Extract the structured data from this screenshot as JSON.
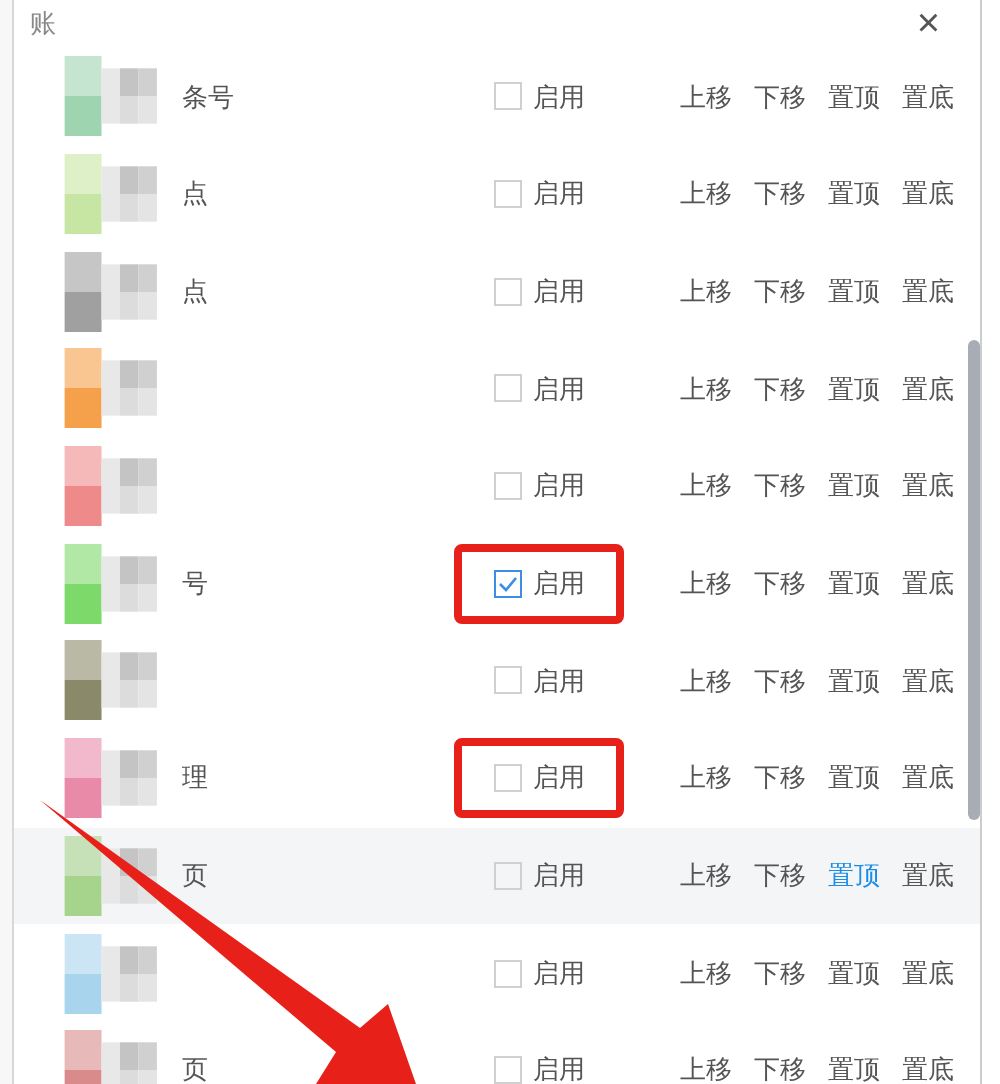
{
  "dialog": {
    "title": "账",
    "close": "×"
  },
  "rows": [
    {
      "name": "条号",
      "color": "#9fd4b0",
      "enabled": false,
      "hovered": false,
      "marked": false,
      "enable_label": "启用",
      "actions": [
        {
          "label": "上移",
          "hover": false
        },
        {
          "label": "下移",
          "hover": false
        },
        {
          "label": "置顶",
          "hover": false
        },
        {
          "label": "置底",
          "hover": false
        }
      ]
    },
    {
      "name": "点",
      "color": "#c7e6a4",
      "enabled": false,
      "hovered": false,
      "marked": false,
      "enable_label": "启用",
      "actions": [
        {
          "label": "上移",
          "hover": false
        },
        {
          "label": "下移",
          "hover": false
        },
        {
          "label": "置顶",
          "hover": false
        },
        {
          "label": "置底",
          "hover": false
        }
      ]
    },
    {
      "name": "点",
      "color": "#a0a0a0",
      "enabled": false,
      "hovered": false,
      "marked": false,
      "enable_label": "启用",
      "actions": [
        {
          "label": "上移",
          "hover": false
        },
        {
          "label": "下移",
          "hover": false
        },
        {
          "label": "置顶",
          "hover": false
        },
        {
          "label": "置底",
          "hover": false
        }
      ]
    },
    {
      "name": "",
      "color": "#f5a04a",
      "enabled": false,
      "hovered": false,
      "marked": false,
      "enable_label": "启用",
      "actions": [
        {
          "label": "上移",
          "hover": false
        },
        {
          "label": "下移",
          "hover": false
        },
        {
          "label": "置顶",
          "hover": false
        },
        {
          "label": "置底",
          "hover": false
        }
      ]
    },
    {
      "name": "",
      "color": "#ef8a8a",
      "enabled": false,
      "hovered": false,
      "marked": false,
      "enable_label": "启用",
      "actions": [
        {
          "label": "上移",
          "hover": false
        },
        {
          "label": "下移",
          "hover": false
        },
        {
          "label": "置顶",
          "hover": false
        },
        {
          "label": "置底",
          "hover": false
        }
      ]
    },
    {
      "name": "号",
      "color": "#7ed96b",
      "enabled": true,
      "hovered": false,
      "marked": true,
      "enable_label": "启用",
      "actions": [
        {
          "label": "上移",
          "hover": false
        },
        {
          "label": "下移",
          "hover": false
        },
        {
          "label": "置顶",
          "hover": false
        },
        {
          "label": "置底",
          "hover": false
        }
      ]
    },
    {
      "name": "",
      "color": "#8a8a6a",
      "enabled": false,
      "hovered": false,
      "marked": false,
      "enable_label": "启用",
      "actions": [
        {
          "label": "上移",
          "hover": false
        },
        {
          "label": "下移",
          "hover": false
        },
        {
          "label": "置顶",
          "hover": false
        },
        {
          "label": "置底",
          "hover": false
        }
      ]
    },
    {
      "name": "理",
      "color": "#e88aa8",
      "enabled": false,
      "hovered": false,
      "marked": true,
      "enable_label": "启用",
      "actions": [
        {
          "label": "上移",
          "hover": false
        },
        {
          "label": "下移",
          "hover": false
        },
        {
          "label": "置顶",
          "hover": false
        },
        {
          "label": "置底",
          "hover": false
        }
      ]
    },
    {
      "name": "页",
      "color": "#a6d48c",
      "enabled": false,
      "hovered": true,
      "marked": false,
      "enable_label": "启用",
      "actions": [
        {
          "label": "上移",
          "hover": false
        },
        {
          "label": "下移",
          "hover": false
        },
        {
          "label": "置顶",
          "hover": true
        },
        {
          "label": "置底",
          "hover": false
        }
      ]
    },
    {
      "name": "",
      "color": "#a8d4ee",
      "enabled": false,
      "hovered": false,
      "marked": false,
      "enable_label": "启用",
      "actions": [
        {
          "label": "上移",
          "hover": false
        },
        {
          "label": "下移",
          "hover": false
        },
        {
          "label": "置顶",
          "hover": false
        },
        {
          "label": "置底",
          "hover": false
        }
      ]
    },
    {
      "name": "页",
      "color": "#d98a8a",
      "enabled": false,
      "hovered": false,
      "marked": false,
      "enable_label": "启用",
      "actions": [
        {
          "label": "上移",
          "hover": false
        },
        {
          "label": "下移",
          "hover": false
        },
        {
          "label": "置顶",
          "hover": false
        },
        {
          "label": "置底",
          "hover": false
        }
      ]
    }
  ],
  "arrow": true
}
